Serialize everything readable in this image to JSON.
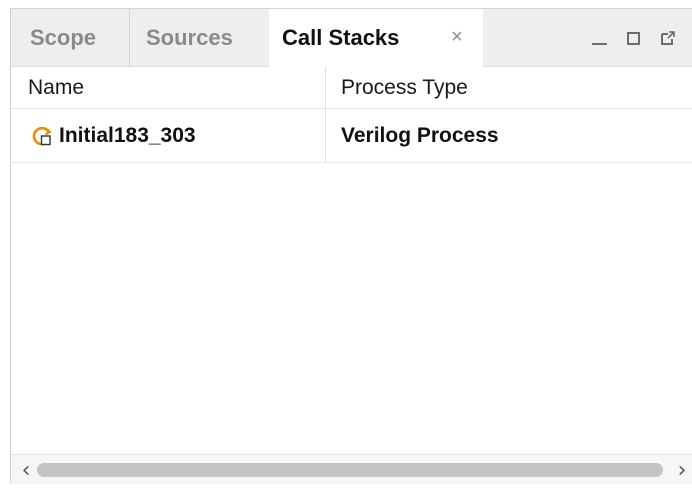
{
  "tabs": [
    {
      "label": "Scope",
      "active": false
    },
    {
      "label": "Sources",
      "active": false
    },
    {
      "label": "Call Stacks",
      "active": true,
      "close_glyph": "×"
    }
  ],
  "window_controls": {
    "minimize_icon": "minimize-icon",
    "maximize_icon": "maximize-icon",
    "float_icon": "float-icon"
  },
  "table": {
    "columns": [
      "Name",
      "Process Type"
    ],
    "rows": [
      {
        "icon": "process-icon",
        "name": "Initial183_303",
        "type": "Verilog Process"
      }
    ]
  },
  "scrollbar": {
    "left_arrow": "‹",
    "right_arrow": "›"
  },
  "colors": {
    "accent_icon": "#f08c00",
    "tabbar_bg": "#eeeeee",
    "inactive_tab_text": "#8a8a8a"
  }
}
